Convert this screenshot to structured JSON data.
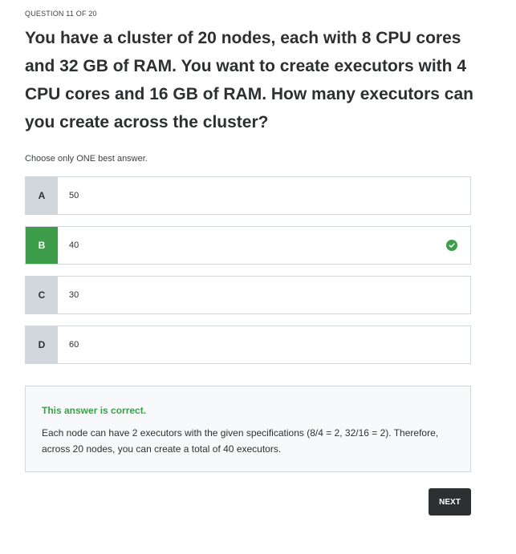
{
  "quiz": {
    "question_counter": "QUESTION 11 OF 20",
    "question_text": "You have a cluster of 20 nodes, each with 8 CPU cores and 32 GB of RAM. You want to create executors with 4 CPU cores and 16 GB of RAM. How many executors can you create across the cluster?",
    "instruction": "Choose only ONE best answer.",
    "options": [
      {
        "letter": "A",
        "text": "50"
      },
      {
        "letter": "B",
        "text": "40"
      },
      {
        "letter": "C",
        "text": "30"
      },
      {
        "letter": "D",
        "text": "60"
      }
    ],
    "selected_option": "B",
    "correct_icon": "check-circle-icon"
  },
  "feedback": {
    "title": "This answer is correct.",
    "body": "Each node can have 2 executors with the given specifications (8/4 = 2, 32/16 = 2). Therefore, across 20 nodes, you can create a total of 40 executors."
  },
  "actions": {
    "next_label": "NEXT"
  },
  "colors": {
    "correct": "#3e9d4b",
    "button_bg": "#2d2f31",
    "letter_bg": "#d1d7dc"
  }
}
